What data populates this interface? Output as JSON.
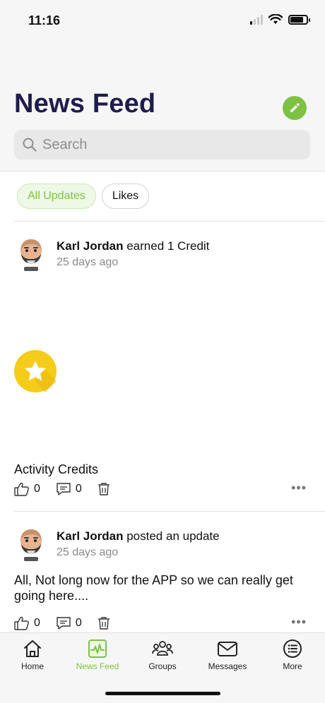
{
  "status_bar": {
    "time": "11:16"
  },
  "header": {
    "title": "News Feed"
  },
  "search": {
    "placeholder": "Search"
  },
  "filters": [
    {
      "label": "All Updates",
      "active": true
    },
    {
      "label": "Likes",
      "active": false
    }
  ],
  "posts": [
    {
      "author": "Karl Jordan",
      "action": "earned 1 Credit",
      "time": "25 days ago",
      "body": "Activity Credits",
      "likes": "0",
      "comments": "0"
    },
    {
      "author": "Karl Jordan",
      "action": "posted an update",
      "time": "25 days ago",
      "body": "All, Not long now for the APP so we can really get going here....",
      "likes": "0",
      "comments": "0"
    }
  ],
  "tabs": [
    {
      "label": "Home",
      "icon": "home-icon"
    },
    {
      "label": "News Feed",
      "icon": "activity-icon",
      "active": true
    },
    {
      "label": "Groups",
      "icon": "groups-icon"
    },
    {
      "label": "Messages",
      "icon": "mail-icon"
    },
    {
      "label": "More",
      "icon": "list-icon"
    }
  ],
  "colors": {
    "accent": "#7dc243",
    "title": "#1e1d4a",
    "badge": "#f6cc1b"
  }
}
